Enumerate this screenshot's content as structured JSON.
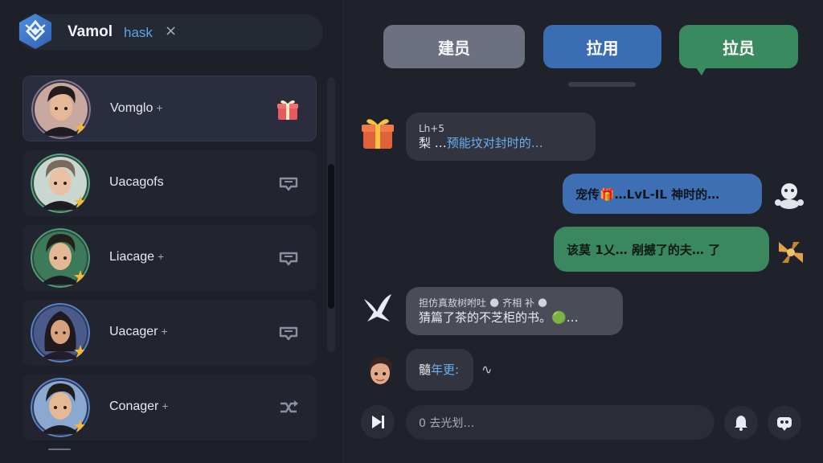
{
  "header": {
    "title": "Vamol",
    "subtitle": "hask",
    "close_icon": "×",
    "logo_icon": "diamond-logo-icon"
  },
  "contacts": [
    {
      "name": "Vomglo",
      "suffix": "+",
      "action_icon": "gift-icon",
      "active": true
    },
    {
      "name": "Uacagofs",
      "suffix": "",
      "action_icon": "chat-icon",
      "active": false
    },
    {
      "name": "Liacage",
      "suffix": "+",
      "action_icon": "chat-icon",
      "active": false
    },
    {
      "name": "Uacager",
      "suffix": "+",
      "action_icon": "chat-icon",
      "active": false
    },
    {
      "name": "Conager",
      "suffix": "+",
      "action_icon": "shuffle-icon",
      "active": false
    }
  ],
  "tabs": [
    {
      "label": "建员",
      "color": "#6c7080"
    },
    {
      "label": "拉用",
      "color": "#3a6db4"
    },
    {
      "label": "拉员",
      "color": "#3a8a5f"
    }
  ],
  "messages": [
    {
      "side": "left",
      "icon": "gift-icon",
      "line1": "Lh+5",
      "line2_prefix": "梨 …",
      "line2_highlight": "预能坟对封时的…"
    },
    {
      "side": "right",
      "icon": "robot-icon",
      "text": "宠传🎁…LvL-IL 神时的…"
    },
    {
      "side": "right",
      "icon": "bow-icon",
      "text": "该莫 1乂… 剐撼了的夫… 了"
    },
    {
      "side": "left",
      "icon": "bird-icon",
      "line1": "担仿真敖树咐吐 🌑 齐相 补 🌑",
      "line2": "猜篇了茶的不芝柜的书。🟢…"
    },
    {
      "side": "left",
      "icon": "avatar-icon",
      "text_prefix": "髓",
      "text_highlight": "年更:",
      "trail": "∿"
    }
  ],
  "composer": {
    "placeholder": "0 去光划…",
    "send_icon": "skip-forward-icon",
    "bell_icon": "bell-icon",
    "bot_icon": "bot-icon"
  },
  "colors": {
    "accent_blue": "#3a6db4",
    "accent_green": "#3a8a5f",
    "highlight": "#6aaef0"
  }
}
